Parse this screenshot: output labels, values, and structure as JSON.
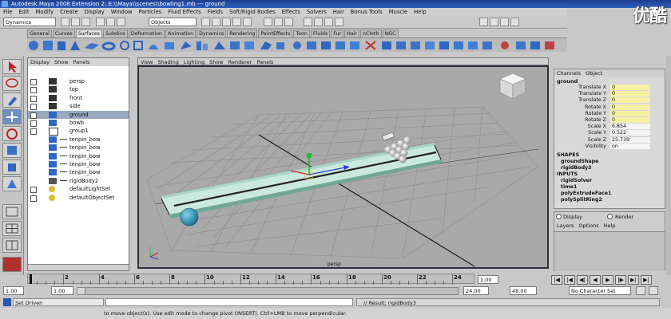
{
  "window": {
    "title": "Autodesk Maya 2008 Extension 2: E:\\\\Maya\\\\scenes\\\\bowling1.mb  ---  ground",
    "watermark": "优酷"
  },
  "menubar": [
    "File",
    "Edit",
    "Modify",
    "Create",
    "Display",
    "Window",
    "Particles",
    "Fluid Effects",
    "Fields",
    "Soft/Rigid Bodies",
    "Effects",
    "Solvers",
    "Hair",
    "Bonus Tools",
    "Muscle",
    "Help"
  ],
  "statusline": {
    "menuset": "Dynamics",
    "selection_mode": "Objects"
  },
  "shelf": {
    "tabs": [
      "General",
      "Curves",
      "Surfaces",
      "Subdivs",
      "Deformation",
      "Animation",
      "Dynamics",
      "Rendering",
      "PaintEffects",
      "Toon",
      "Fluids",
      "Fur",
      "Hair",
      "nCloth",
      "NGC"
    ],
    "active_tab": "Surfaces"
  },
  "outliner": {
    "menu": [
      "Display",
      "Show",
      "Panels"
    ],
    "items": [
      {
        "label": "persp",
        "icon": "camera-icon",
        "indent": 0,
        "selected": false
      },
      {
        "label": "top",
        "icon": "camera-icon",
        "indent": 0,
        "selected": false
      },
      {
        "label": "front",
        "icon": "camera-icon",
        "indent": 0,
        "selected": false
      },
      {
        "label": "side",
        "icon": "camera-icon",
        "indent": 0,
        "selected": false
      },
      {
        "label": "ground",
        "icon": "mesh-icon",
        "indent": 0,
        "selected": true
      },
      {
        "label": "bowb",
        "icon": "mesh-icon",
        "indent": 0,
        "selected": false
      },
      {
        "label": "group1",
        "icon": "group-icon",
        "indent": 0,
        "selected": false
      },
      {
        "label": "tenpin_bow",
        "icon": "mesh-icon",
        "indent": 1,
        "selected": false
      },
      {
        "label": "tenpin_bow",
        "icon": "mesh-icon",
        "indent": 1,
        "selected": false
      },
      {
        "label": "tenpin_bow",
        "icon": "mesh-icon",
        "indent": 1,
        "selected": false
      },
      {
        "label": "tenpin_bow",
        "icon": "mesh-icon",
        "indent": 1,
        "selected": false
      },
      {
        "label": "tenpin_bow",
        "icon": "mesh-icon",
        "indent": 1,
        "selected": false
      },
      {
        "label": "rigidBody2",
        "icon": "rigid-icon",
        "indent": 1,
        "selected": false
      },
      {
        "label": "defaultLightSet",
        "icon": "set-icon",
        "indent": 0,
        "selected": false
      },
      {
        "label": "defaultObjectSet",
        "icon": "set-icon",
        "indent": 0,
        "selected": false
      }
    ]
  },
  "viewport": {
    "menu": [
      "View",
      "Shading",
      "Lighting",
      "Show",
      "Renderer",
      "Panels"
    ],
    "camera_label": "persp"
  },
  "channelbox": {
    "menu": [
      "Channels",
      "Object"
    ],
    "object": "ground",
    "channels": [
      {
        "name": "Translate X",
        "value": "0",
        "style": "yellow"
      },
      {
        "name": "Translate Y",
        "value": "0",
        "style": "yellow"
      },
      {
        "name": "Translate Z",
        "value": "0",
        "style": "yellow"
      },
      {
        "name": "Rotate X",
        "value": "0",
        "style": "yellow"
      },
      {
        "name": "Rotate Y",
        "value": "0",
        "style": "yellow"
      },
      {
        "name": "Rotate Z",
        "value": "0",
        "style": "yellow"
      },
      {
        "name": "Scale X",
        "value": "6.854",
        "style": "white"
      },
      {
        "name": "Scale Y",
        "value": "0.522",
        "style": "white"
      },
      {
        "name": "Scale Z",
        "value": "25.739",
        "style": "white"
      },
      {
        "name": "Visibility",
        "value": "on",
        "style": "white"
      }
    ],
    "shapes_header": "SHAPES",
    "shapes": [
      "groundShape",
      "rigidBody3"
    ],
    "inputs_header": "INPUTS",
    "inputs": [
      "rigidSolver",
      "time1",
      "polyExtrudeFace1",
      "polySplitRing2"
    ]
  },
  "layers": {
    "display_label": "Display",
    "render_label": "Render",
    "menu": [
      "Layers",
      "Options",
      "Help"
    ]
  },
  "timeslider": {
    "ticks": [
      "2",
      "4",
      "6",
      "8",
      "10",
      "12",
      "14",
      "16",
      "18",
      "20",
      "22",
      "24"
    ],
    "current_frame": "1.00",
    "range_start": "1.00",
    "range_inner_start": "1.00",
    "range_end": "24.00",
    "range_inner_end": "48.00",
    "character_set": "No Character Set"
  },
  "commandline": {
    "mel_label": "Set Driven",
    "result": "// Result: rigidBody3"
  },
  "helpline": {
    "text": "to move object(s). Use edit mode to change pivot (INSERT).  Ctrl+LMB to move perpendicular."
  },
  "colors": {
    "title_bar": "#2a55b0",
    "viewport_bg": "#a9a9a9",
    "ground": "#c9e9dc",
    "ball": "#2b98bf",
    "selection_highlight": "#9aa8c0"
  }
}
